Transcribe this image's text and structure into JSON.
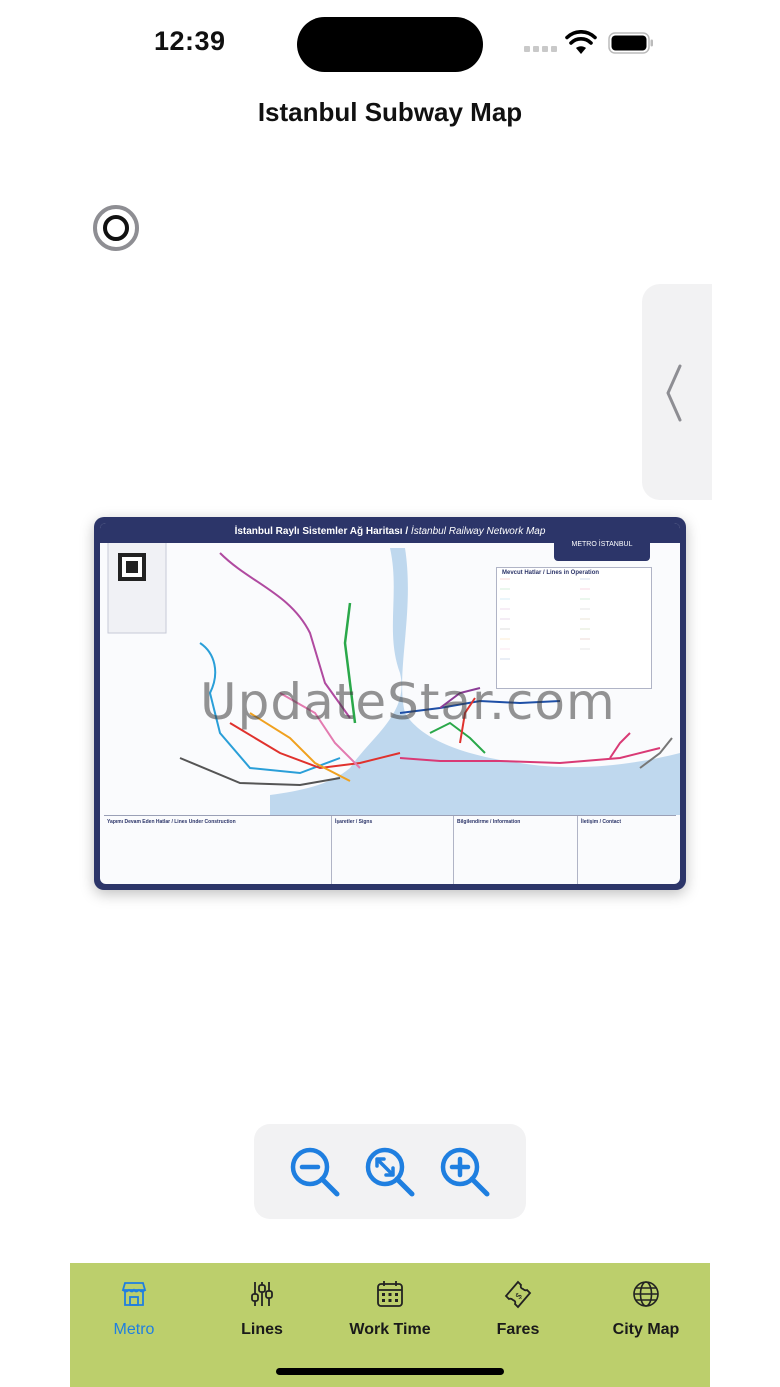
{
  "status_bar": {
    "time": "12:39"
  },
  "header": {
    "title": "Istanbul Subway Map"
  },
  "map": {
    "title_tr": "İstanbul Raylı Sistemler Ağ Haritası /",
    "title_en": "İstanbul Railway Network Map",
    "logo_text": "METRO İSTANBUL",
    "watermark": "UpdateStar.com",
    "legend_title": "Mevcut Hatlar / Lines in Operation",
    "strip_sections": [
      "Yapımı Devam Eden Hatlar / Lines Under Construction",
      "İşaretler / Signs",
      "Bilgilendirme / Information",
      "İletişim / Contact"
    ],
    "colors": {
      "frame": "#2c3569",
      "sea": "#bfd8ee"
    }
  },
  "zoom": {
    "icons": [
      "zoom-out-icon",
      "zoom-fit-icon",
      "zoom-in-icon"
    ],
    "accent": "#1f7fe0"
  },
  "tabs": [
    {
      "label": "Metro",
      "icon": "store-icon",
      "active": true
    },
    {
      "label": "Lines",
      "icon": "sliders-icon",
      "active": false
    },
    {
      "label": "Work Time",
      "icon": "calendar-icon",
      "active": false
    },
    {
      "label": "Fares",
      "icon": "ticket-icon",
      "active": false
    },
    {
      "label": "City Map",
      "icon": "globe-icon",
      "active": false
    }
  ],
  "tab_bar_color": "#bccf6c"
}
